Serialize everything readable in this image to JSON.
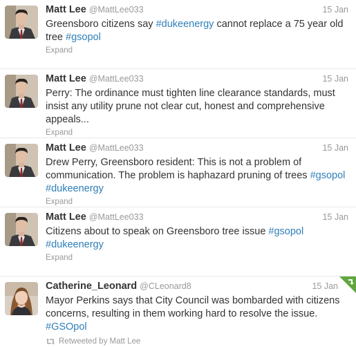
{
  "tweets": [
    {
      "name": "Matt Lee",
      "handle": "@MattLee033",
      "time": "15 Jan",
      "segments": [
        {
          "text": "Greensboro citizens say ",
          "tag": false
        },
        {
          "text": "#dukeenergy",
          "tag": true
        },
        {
          "text": " cannot replace a 75 year old tree ",
          "tag": false
        },
        {
          "text": "#gsopol",
          "tag": true
        }
      ],
      "expand": "Expand",
      "avatar": "matt-lee-avatar"
    },
    {
      "name": "Matt Lee",
      "handle": "@MattLee033",
      "time": "15 Jan",
      "segments": [
        {
          "text": "Perry: The ordinance must tighten line clearance standards, must insist any utility prune not clear cut, honest and comprehensive appeals...",
          "tag": false
        }
      ],
      "expand": "Expand",
      "avatar": "matt-lee-avatar"
    },
    {
      "name": "Matt Lee",
      "handle": "@MattLee033",
      "time": "15 Jan",
      "segments": [
        {
          "text": "Drew Perry, Greensboro resident: This is not a problem of communication. The problem is haphazard pruning of trees ",
          "tag": false
        },
        {
          "text": "#gsopol",
          "tag": true
        },
        {
          "text": " ",
          "tag": false
        },
        {
          "text": "#dukeenergy",
          "tag": true
        }
      ],
      "expand": "Expand",
      "avatar": "matt-lee-avatar"
    },
    {
      "name": "Matt Lee",
      "handle": "@MattLee033",
      "time": "15 Jan",
      "segments": [
        {
          "text": "Citizens about to speak on Greensboro tree issue ",
          "tag": false
        },
        {
          "text": "#gsopol",
          "tag": true
        },
        {
          "text": " ",
          "tag": false
        },
        {
          "text": "#dukeenergy",
          "tag": true
        }
      ],
      "expand": "Expand",
      "avatar": "matt-lee-avatar"
    },
    {
      "name": "Catherine_Leonard",
      "handle": "@CLeonard8",
      "time": "15 Jan",
      "segments": [
        {
          "text": "Mayor Perkins says that City Council was bombarded with citizens concerns, resulting in them working hard to resolve the issue. ",
          "tag": false
        },
        {
          "text": "#GSOpol",
          "tag": true
        }
      ],
      "retweeted_by": "Retweeted by Matt Lee",
      "avatar": "catherine-leonard-avatar",
      "corner_badge": "retweet-corner-icon"
    }
  ],
  "colors": {
    "hashtag": "#2f7fb8",
    "retweet_corner": "#5fa73e",
    "meta": "#999999"
  }
}
